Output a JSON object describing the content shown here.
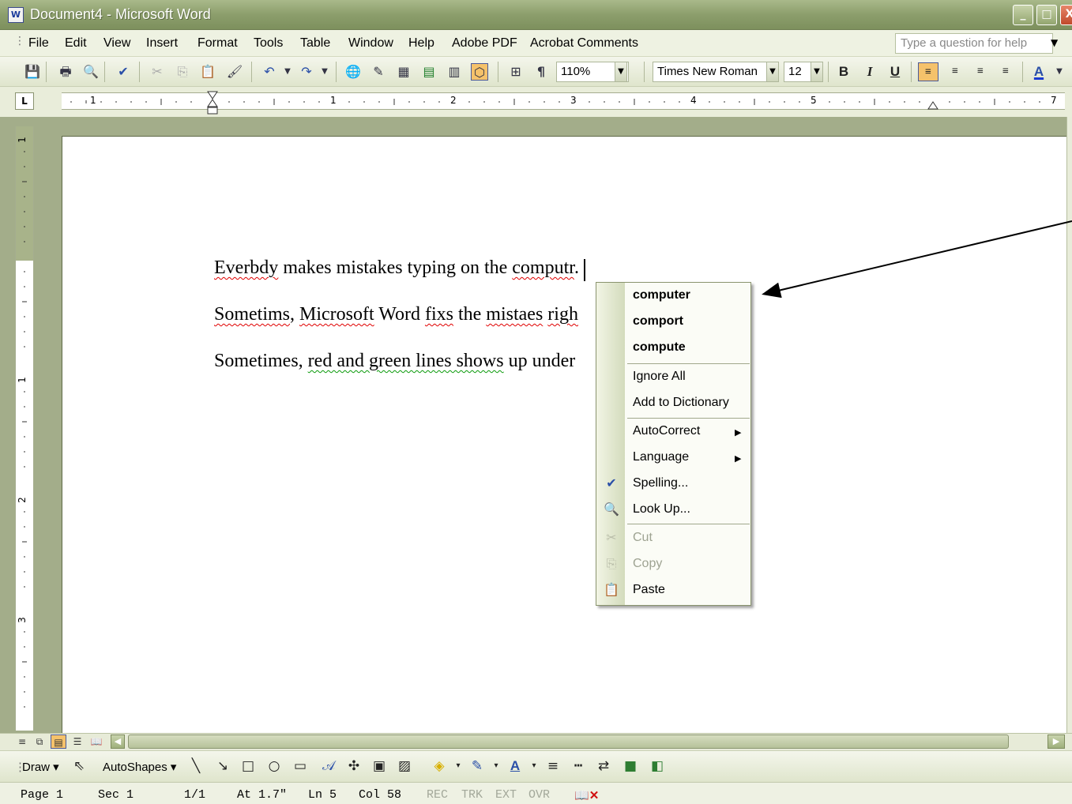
{
  "window": {
    "title": "Document4 - Microsoft Word",
    "icon_text": "W"
  },
  "menu": {
    "items": [
      "File",
      "Edit",
      "View",
      "Insert",
      "Format",
      "Tools",
      "Table",
      "Window",
      "Help",
      "Adobe PDF",
      "Acrobat Comments"
    ],
    "help_placeholder": "Type a question for help"
  },
  "toolbar": {
    "zoom": "110%",
    "font_name": "Times New Roman",
    "font_size": "12",
    "bold_label": "B",
    "italic_label": "I",
    "underline_label": "U",
    "pilcrow": "¶"
  },
  "ruler": {
    "h_labels": [
      "1",
      "1",
      "2",
      "3",
      "4",
      "5",
      "7"
    ],
    "v_labels": [
      "1",
      "1",
      "2",
      "3"
    ],
    "tab_selector": "L"
  },
  "document": {
    "line1": {
      "w1": "Everbdy",
      "mid": " makes mistakes typing on the ",
      "w2": "computr",
      "end": "."
    },
    "line2": {
      "w1": "Sometims",
      "mid1": ", ",
      "w2": "Microsoft",
      "mid2": " Word ",
      "w3": "fixs",
      "mid3": " the ",
      "w4": "mistaes",
      "mid4": " ",
      "w5": "righ"
    },
    "line3": {
      "start": "Sometimes, ",
      "green": "red and green lines shows",
      "end": " up under"
    }
  },
  "context_menu": {
    "suggestions": [
      "computer",
      "comport",
      "compute"
    ],
    "ignore_all": "Ignore All",
    "add_to_dictionary": "Add to Dictionary",
    "autocorrect": "AutoCorrect",
    "language": "Language",
    "spelling": "Spelling...",
    "look_up": "Look Up...",
    "cut": "Cut",
    "copy": "Copy",
    "paste": "Paste"
  },
  "drawing_toolbar": {
    "draw": "Draw",
    "autoshapes": "AutoShapes"
  },
  "status_bar": {
    "page": "Page 1",
    "sec": "Sec 1",
    "pages": "1/1",
    "at": "At 1.7\"",
    "ln": "Ln 5",
    "col": "Col 58",
    "rec": "REC",
    "trk": "TRK",
    "ext": "EXT",
    "ovr": "OVR"
  },
  "icons": [
    "word-doc-icon",
    "minimize-icon",
    "maximize-icon",
    "close-icon",
    "save-icon",
    "print-icon",
    "print-preview-icon",
    "spelling-icon",
    "cut-icon",
    "copy-icon",
    "paste-icon",
    "format-painter-icon",
    "undo-icon",
    "redo-icon",
    "hyperlink-icon",
    "table-icon",
    "excel-icon",
    "columns-icon",
    "drawing-icon",
    "document-map-icon",
    "show-hide-icon",
    "align-left-icon",
    "center-icon",
    "align-right-icon",
    "justify-icon",
    "font-color-icon",
    "cursor-icon",
    "line-icon",
    "arrow-icon",
    "rectangle-icon",
    "oval-icon",
    "textbox-icon",
    "wordart-icon",
    "diagram-icon",
    "clipart-icon",
    "picture-icon",
    "fill-color-icon",
    "line-color-icon",
    "line-style-icon",
    "dash-style-icon",
    "arrow-style-icon",
    "shadow-icon",
    "3d-icon"
  ],
  "colors": {
    "title_bar": "#8c9e6c",
    "spelling_error": "#e00000",
    "grammar_error": "#0a9a0a",
    "active_button": "#f5c26b"
  }
}
